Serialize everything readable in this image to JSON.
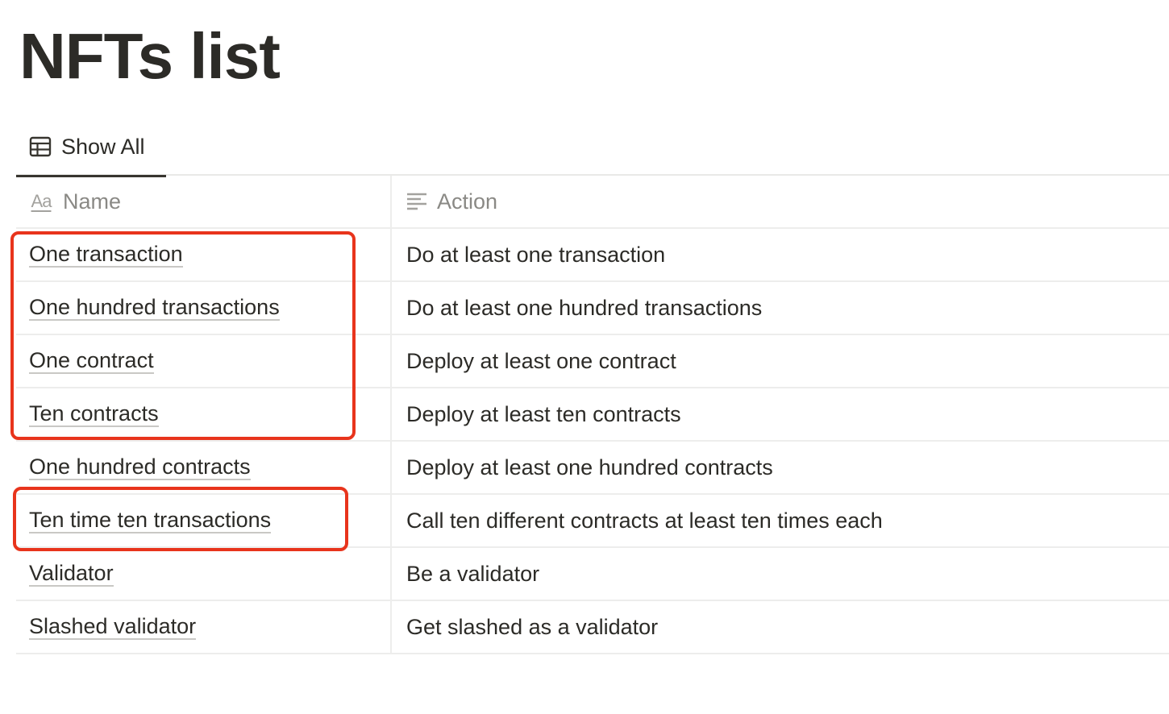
{
  "page": {
    "title": "NFTs list"
  },
  "tabs": [
    {
      "label": "Show All",
      "icon": "table-icon",
      "active": true
    }
  ],
  "table": {
    "columns": [
      {
        "label": "Name",
        "icon": "text-title-icon"
      },
      {
        "label": "Action",
        "icon": "text-lines-icon"
      }
    ],
    "rows": [
      {
        "name": "One transaction",
        "action": "Do at least one transaction"
      },
      {
        "name": "One hundred transactions",
        "action": "Do at least one hundred transactions"
      },
      {
        "name": "One contract",
        "action": "Deploy at least one contract"
      },
      {
        "name": "Ten contracts",
        "action": "Deploy at least ten contracts"
      },
      {
        "name": "One hundred contracts",
        "action": "Deploy at least one hundred contracts"
      },
      {
        "name": "Ten time ten transactions",
        "action": "Call ten different contracts at least ten times each"
      },
      {
        "name": "Validator",
        "action": "Be a validator"
      },
      {
        "name": "Slashed validator",
        "action": "Get slashed as a validator"
      }
    ]
  },
  "annotations": {
    "highlight_color": "#e8341c",
    "highlighted_groups": [
      [
        "One transaction",
        "One hundred transactions",
        "One contract",
        "Ten contracts"
      ],
      [
        "Ten time ten transactions"
      ]
    ]
  },
  "colors": {
    "text": "#37352f",
    "muted": "#8a8985",
    "border": "#ededec"
  }
}
